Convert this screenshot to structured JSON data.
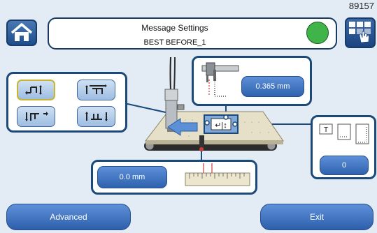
{
  "corner_code": "89157",
  "header": {
    "title": "Message Settings",
    "subtitle": "BEST BEFORE_1",
    "status_color": "#41b449"
  },
  "icons": {
    "home": "home-icon",
    "menu": "touch-menu-icon"
  },
  "direction_options": [
    "direction-option-1",
    "direction-option-2",
    "direction-option-3",
    "direction-option-4"
  ],
  "selected_direction_index": 0,
  "height_setting": {
    "value": "0.365 mm"
  },
  "offset_setting": {
    "value": "0.0 mm"
  },
  "repeat_setting": {
    "value": "0"
  },
  "footer": {
    "advanced_label": "Advanced",
    "exit_label": "Exit"
  },
  "colors": {
    "accent": "#2f62ae",
    "panel_border": "#1b4a7a",
    "background": "#e3ecf4"
  }
}
